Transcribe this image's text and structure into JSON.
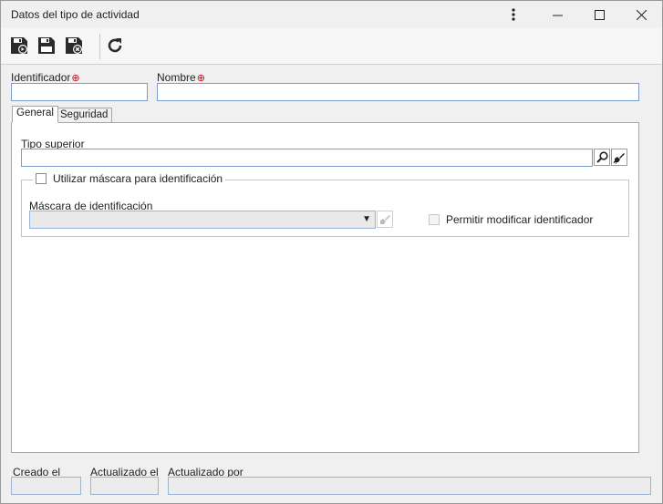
{
  "window": {
    "title": "Datos del tipo de actividad",
    "menu_icon": "more-vertical-icon",
    "minimize_icon": "minimize-icon",
    "maximize_icon": "maximize-icon",
    "close_icon": "close-icon"
  },
  "toolbar": {
    "buttons": [
      {
        "name": "save-and-new",
        "icon": "save-new-icon"
      },
      {
        "name": "save",
        "icon": "save-icon"
      },
      {
        "name": "save-and-close",
        "icon": "save-close-icon"
      },
      {
        "name": "refresh",
        "icon": "refresh-icon"
      }
    ]
  },
  "form": {
    "identificador_label": "Identificador",
    "identificador_value": "",
    "nombre_label": "Nombre",
    "nombre_value": "",
    "required_mark": "⊕"
  },
  "tabs": [
    {
      "label": "General",
      "active": true
    },
    {
      "label": "Seguridad",
      "active": false
    }
  ],
  "general": {
    "tipo_superior_label": "Tipo superior",
    "tipo_superior_value": "",
    "mask_group_label": "Utilizar máscara para identificación",
    "mask_group_checked": false,
    "mascara_label": "Máscara de identificación",
    "mascara_value": "",
    "permitir_label": "Permitir modificar identificador",
    "permitir_checked": false
  },
  "footer": {
    "creado_label": "Creado el",
    "creado_value": "",
    "actualizado_label": "Actualizado el",
    "actualizado_value": "",
    "actualizado_por_label": "Actualizado por",
    "actualizado_por_value": ""
  },
  "colors": {
    "required": "#d9001b",
    "input_border": "#7a9cc8",
    "window_bg": "#f0f0f0"
  }
}
